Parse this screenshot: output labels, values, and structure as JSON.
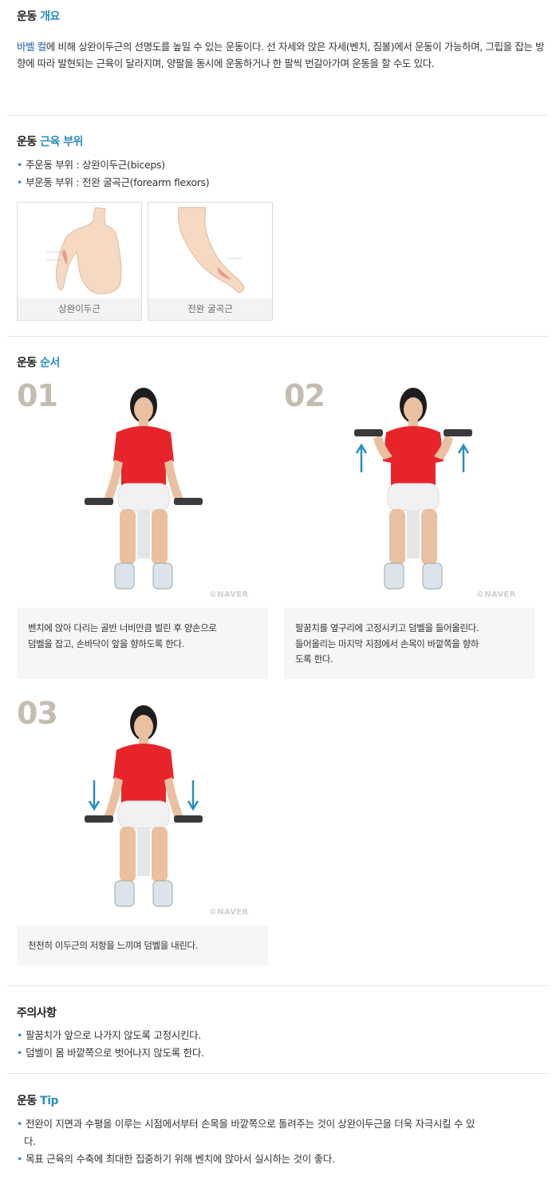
{
  "overview": {
    "title_prefix": "운동 ",
    "title_highlight": "개요",
    "text_link": "바벨 컬",
    "text_rest": "에 비해 상완이두근의 선명도를 높일 수 있는 운동이다. 선 자세와 앉은 자세(벤치, 짐볼)에서 운동이 가능하며, 그립을 잡는 방향에 따라 발현되는 근육이 달라지며, 양팔을 동시에 운동하거나 한 팔씩 번갈아가며 운동을 할 수도 있다."
  },
  "muscles": {
    "title_prefix": "운동 ",
    "title_highlight": "근육 부위",
    "primary": "주운동 부위 : 상완이두근(biceps)",
    "secondary": "부운동 부위 : 전완 굴곡근(forearm flexors)",
    "cards": [
      {
        "caption": "상완이두근"
      },
      {
        "caption": "전완 굴곡근"
      }
    ]
  },
  "steps": {
    "title_prefix": "운동 ",
    "title_highlight": "순서",
    "watermark": "©NAVER",
    "items": [
      {
        "number": "01",
        "line1": "벤치에 앉아 다리는 골반 너비만큼 벌린 후 양손으로",
        "line2": "덤벨을 잡고, 손바닥이 앞을 향하도록 한다.",
        "line3": ""
      },
      {
        "number": "02",
        "line1": "팔꿈치를 옆구리에 고정시키고 덤벨을 들어올린다.",
        "line2": "들어올리는 마지막 지점에서 손목이 바깥쪽을 향하",
        "line3": "도록 한다."
      },
      {
        "number": "03",
        "line1": "천천히 이두근의 저항을 느끼며 덤벨을 내린다.",
        "line2": "",
        "line3": ""
      }
    ]
  },
  "caution": {
    "title": "주의사항",
    "items": [
      "팔꿈치가 앞으로 나가지 않도록 고정시킨다.",
      "덤벨이 몸 바깥쪽으로 벗어나지 않도록 한다."
    ]
  },
  "tip": {
    "title_prefix": "운동 ",
    "title_highlight": "Tip",
    "items": [
      "전완이 지면과 수평을 이루는 시점에서부터 손목을 바깥쪽으로 돌려주는 것이 상완이두근을 더욱 자극시킬 수 있",
      "다.",
      "목표 근육의 수축에 최대한 집중하기 위해 벤치에 앉아서 실시하는 것이 좋다."
    ]
  },
  "colors": {
    "accent": "#2a8dbf",
    "step_number": "#c5bcb1",
    "shirt": "#e8242b",
    "arrow": "#2a8dbf"
  }
}
